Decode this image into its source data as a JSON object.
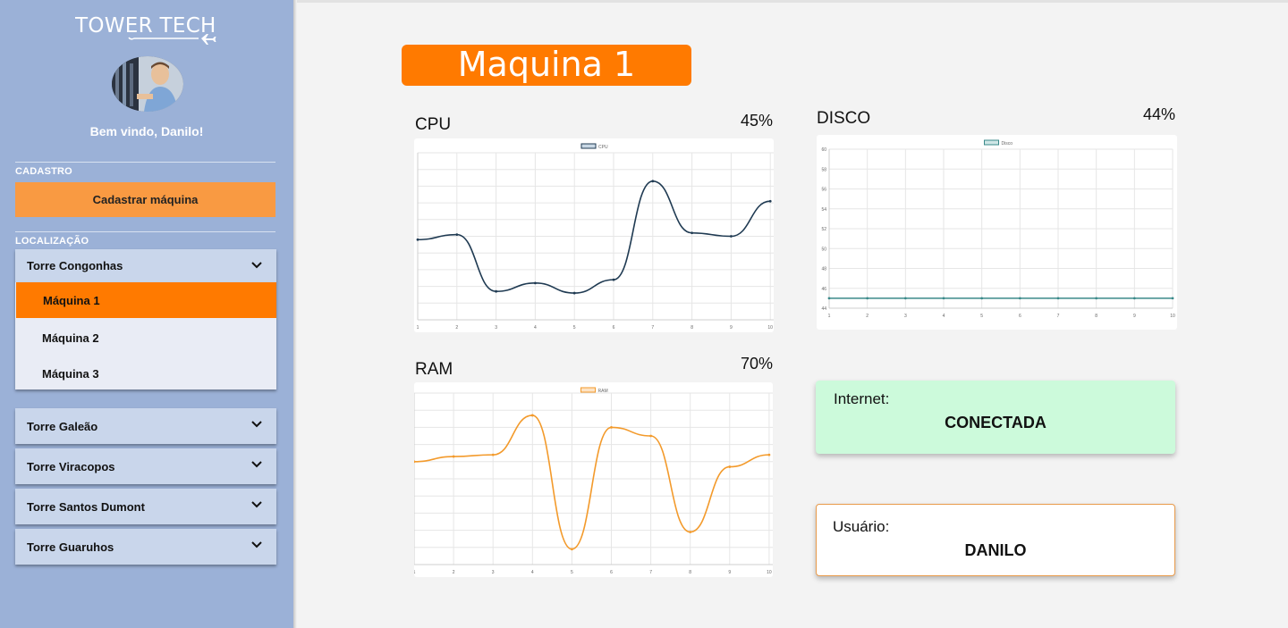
{
  "brand": {
    "name": "TOWER TECH"
  },
  "sidebar": {
    "welcome": "Bem vindo, Danilo!",
    "cadastro_label": "CADASTRO",
    "cadastrar_button": "Cadastrar máquina",
    "localizacao_label": "LOCALIZAÇÃO",
    "towers": [
      {
        "label": "Torre Congonhas"
      },
      {
        "label": "Torre Galeão"
      },
      {
        "label": "Torre Viracopos"
      },
      {
        "label": "Torre Santos Dumont"
      },
      {
        "label": "Torre Guaruhos"
      }
    ],
    "machines": [
      {
        "label": "Máquina 1",
        "active": true
      },
      {
        "label": "Máquina 2",
        "active": false
      },
      {
        "label": "Máquina 3",
        "active": false
      }
    ]
  },
  "main": {
    "title": "Maquina 1",
    "cpu": {
      "label": "CPU",
      "percent": "45%"
    },
    "disco": {
      "label": "DISCO",
      "percent": "44%"
    },
    "ram": {
      "label": "RAM",
      "percent": "70%"
    },
    "internet": {
      "label": "Internet:",
      "value": "CONECTADA"
    },
    "usuario": {
      "label": "Usuário:",
      "value": "DANILO"
    }
  },
  "colors": {
    "accent": "#ff7a00",
    "sidebar": "#9bb1d7",
    "cpu_line": "#1f3a52",
    "disk_line": "#3a8a8a",
    "ram_line": "#f39a2b",
    "internet_bg": "#ccfadb",
    "user_border": "#e89a4a"
  },
  "chart_data": [
    {
      "type": "line",
      "legend": "CPU",
      "x": [
        "1",
        "2",
        "3",
        "4",
        "5",
        "6",
        "7",
        "8",
        "9",
        "10"
      ],
      "series": [
        {
          "name": "CPU",
          "values": [
            48,
            51,
            17,
            22,
            16,
            24,
            83,
            52,
            50,
            71
          ]
        }
      ],
      "ylim": [
        0,
        100
      ],
      "grid": true
    },
    {
      "type": "line",
      "legend": "Disco",
      "x": [
        "1",
        "2",
        "3",
        "4",
        "5",
        "6",
        "7",
        "8",
        "9",
        "10"
      ],
      "series": [
        {
          "name": "Disco",
          "values": [
            45,
            45,
            45,
            45,
            45,
            45,
            45,
            45,
            45,
            45
          ]
        }
      ],
      "yticks": [
        "60",
        "58",
        "56",
        "54",
        "52",
        "50",
        "48",
        "46",
        "44"
      ],
      "ylim": [
        44,
        60
      ],
      "grid": true
    },
    {
      "type": "line",
      "legend": "RAM",
      "x": [
        "1",
        "2",
        "3",
        "4",
        "5",
        "6",
        "7",
        "8",
        "9",
        "10"
      ],
      "series": [
        {
          "name": "RAM",
          "values": [
            60,
            63,
            64,
            87,
            9,
            80,
            75,
            19,
            57,
            64
          ]
        }
      ],
      "ylim": [
        0,
        100
      ],
      "grid": true
    }
  ]
}
